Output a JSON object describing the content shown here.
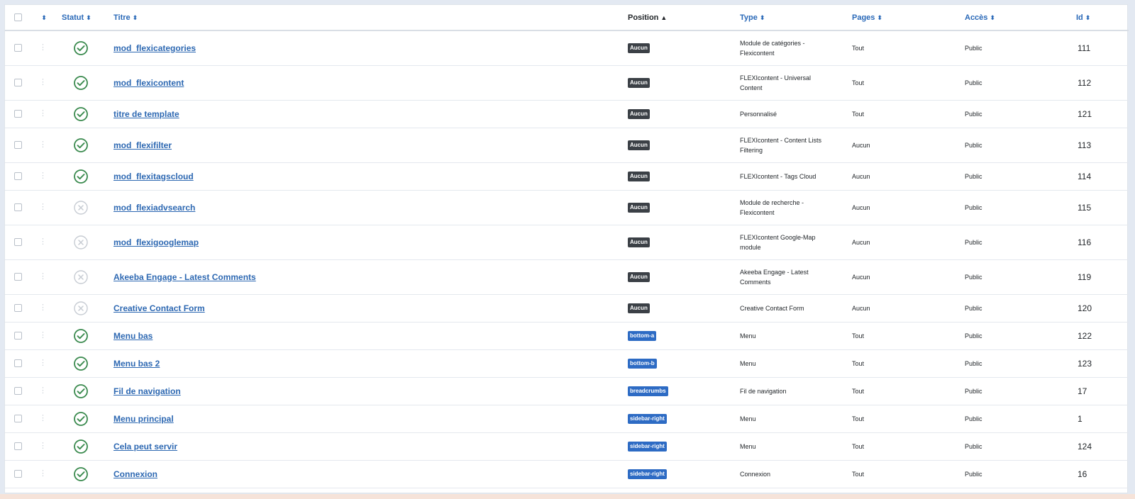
{
  "colors": {
    "link": "#2d68b2",
    "published": "#3a8a4e",
    "unpublished": "#c7ccd3",
    "badge_none": "#3b4046",
    "badge_position": "#2d6bc4"
  },
  "header": {
    "status": "Statut",
    "title": "Titre",
    "position": "Position",
    "type": "Type",
    "pages": "Pages",
    "access": "Accès",
    "id": "Id",
    "sort_icon": "sort-icon",
    "sort_asc_icon": "caret-up-icon"
  },
  "rows": [
    {
      "title": "mod_flexicategories",
      "published": true,
      "position": "Aucun",
      "position_kind": "none",
      "type": "Module de catégories - Flexicontent",
      "pages": "Tout",
      "access": "Public",
      "id": "111"
    },
    {
      "title": "mod_flexicontent",
      "published": true,
      "position": "Aucun",
      "position_kind": "none",
      "type": "FLEXIcontent - Universal Content",
      "pages": "Tout",
      "access": "Public",
      "id": "112"
    },
    {
      "title": "titre de template",
      "published": true,
      "position": "Aucun",
      "position_kind": "none",
      "type": "Personnalisé",
      "pages": "Tout",
      "access": "Public",
      "id": "121"
    },
    {
      "title": "mod_flexifilter",
      "published": true,
      "position": "Aucun",
      "position_kind": "none",
      "type": "FLEXIcontent - Content Lists Filtering",
      "pages": "Aucun",
      "access": "Public",
      "id": "113"
    },
    {
      "title": "mod_flexitagscloud",
      "published": true,
      "position": "Aucun",
      "position_kind": "none",
      "type": "FLEXIcontent - Tags Cloud",
      "pages": "Aucun",
      "access": "Public",
      "id": "114"
    },
    {
      "title": "mod_flexiadvsearch",
      "published": false,
      "position": "Aucun",
      "position_kind": "none",
      "type": "Module de recherche - Flexicontent",
      "pages": "Aucun",
      "access": "Public",
      "id": "115"
    },
    {
      "title": "mod_flexigooglemap",
      "published": false,
      "position": "Aucun",
      "position_kind": "none",
      "type": "FLEXIcontent Google-Map module",
      "pages": "Aucun",
      "access": "Public",
      "id": "116"
    },
    {
      "title": "Akeeba Engage - Latest Comments",
      "published": false,
      "position": "Aucun",
      "position_kind": "none",
      "type": "Akeeba Engage - Latest Comments",
      "pages": "Aucun",
      "access": "Public",
      "id": "119"
    },
    {
      "title": "Creative Contact Form",
      "published": false,
      "position": "Aucun",
      "position_kind": "none",
      "type": "Creative Contact Form",
      "pages": "Aucun",
      "access": "Public",
      "id": "120"
    },
    {
      "title": "Menu bas",
      "published": true,
      "position": "bottom-a",
      "position_kind": "pos",
      "type": "Menu",
      "pages": "Tout",
      "access": "Public",
      "id": "122"
    },
    {
      "title": "Menu bas 2",
      "published": true,
      "position": "bottom-b",
      "position_kind": "pos",
      "type": "Menu",
      "pages": "Tout",
      "access": "Public",
      "id": "123"
    },
    {
      "title": "Fil de navigation",
      "published": true,
      "position": "breadcrumbs",
      "position_kind": "pos",
      "type": "Fil de navigation",
      "pages": "Tout",
      "access": "Public",
      "id": "17"
    },
    {
      "title": "Menu principal",
      "published": true,
      "position": "sidebar-right",
      "position_kind": "pos",
      "type": "Menu",
      "pages": "Tout",
      "access": "Public",
      "id": "1"
    },
    {
      "title": "Cela peut servir",
      "published": true,
      "position": "sidebar-right",
      "position_kind": "pos",
      "type": "Menu",
      "pages": "Tout",
      "access": "Public",
      "id": "124"
    },
    {
      "title": "Connexion",
      "published": true,
      "position": "sidebar-right",
      "position_kind": "pos",
      "type": "Connexion",
      "pages": "Tout",
      "access": "Public",
      "id": "16"
    }
  ]
}
